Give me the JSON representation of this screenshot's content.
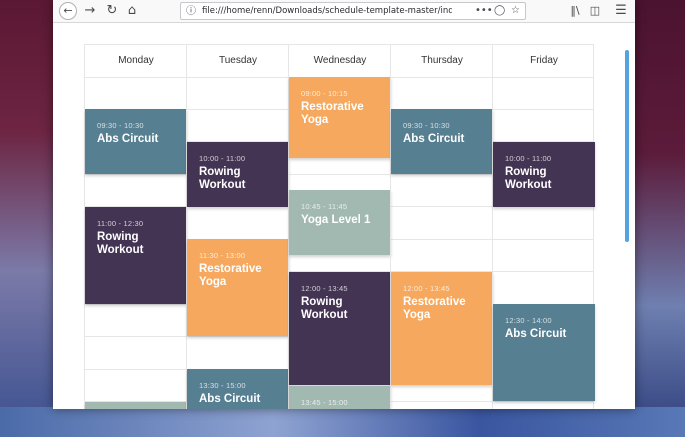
{
  "browser": {
    "url": "file:///home/renn/Downloads/schedule-template-master/inde",
    "icons": {
      "back": "arrow-left-icon",
      "forward": "arrow-right-icon",
      "reload": "reload-icon",
      "home": "home-icon",
      "info": "info-icon",
      "more": "more-icon",
      "pocket": "pocket-icon",
      "bookmark": "star-icon",
      "library": "library-icon",
      "sidebar": "sidebar-icon",
      "menu": "hamburger-menu-icon"
    }
  },
  "schedule": {
    "days": [
      "Monday",
      "Tuesday",
      "Wednesday",
      "Thursday",
      "Friday"
    ],
    "event_colors": {
      "abs": "#577f92",
      "rowing": "#443453",
      "restorative": "#f6a95e",
      "yoga": "#a2b9b2"
    },
    "events": {
      "mon_1": {
        "time": "09:30 - 10:30",
        "name": "Abs Circuit"
      },
      "mon_2": {
        "time": "11:00 - 12:30",
        "name": "Rowing Workout"
      },
      "tue_1": {
        "time": "10:00 - 11:00",
        "name": "Rowing Workout"
      },
      "tue_2": {
        "time": "11:30 - 13:00",
        "name": "Restorative Yoga"
      },
      "tue_3": {
        "time": "13:30 - 15:00",
        "name": "Abs Circuit"
      },
      "wed_1": {
        "time": "09:00 - 10:15",
        "name": "Restorative Yoga"
      },
      "wed_2": {
        "time": "10:45 - 11:45",
        "name": "Yoga Level 1"
      },
      "wed_3": {
        "time": "12:00 - 13:45",
        "name": "Rowing Workout"
      },
      "wed_4": {
        "time": "13:45 - 15:00",
        "name": ""
      },
      "thu_1": {
        "time": "09:30 - 10:30",
        "name": "Abs Circuit"
      },
      "thu_2": {
        "time": "12:00 - 13:45",
        "name": "Restorative Yoga"
      },
      "fri_1": {
        "time": "10:00 - 11:00",
        "name": "Rowing Workout"
      },
      "fri_2": {
        "time": "12:30 - 14:00",
        "name": "Abs Circuit"
      }
    }
  }
}
